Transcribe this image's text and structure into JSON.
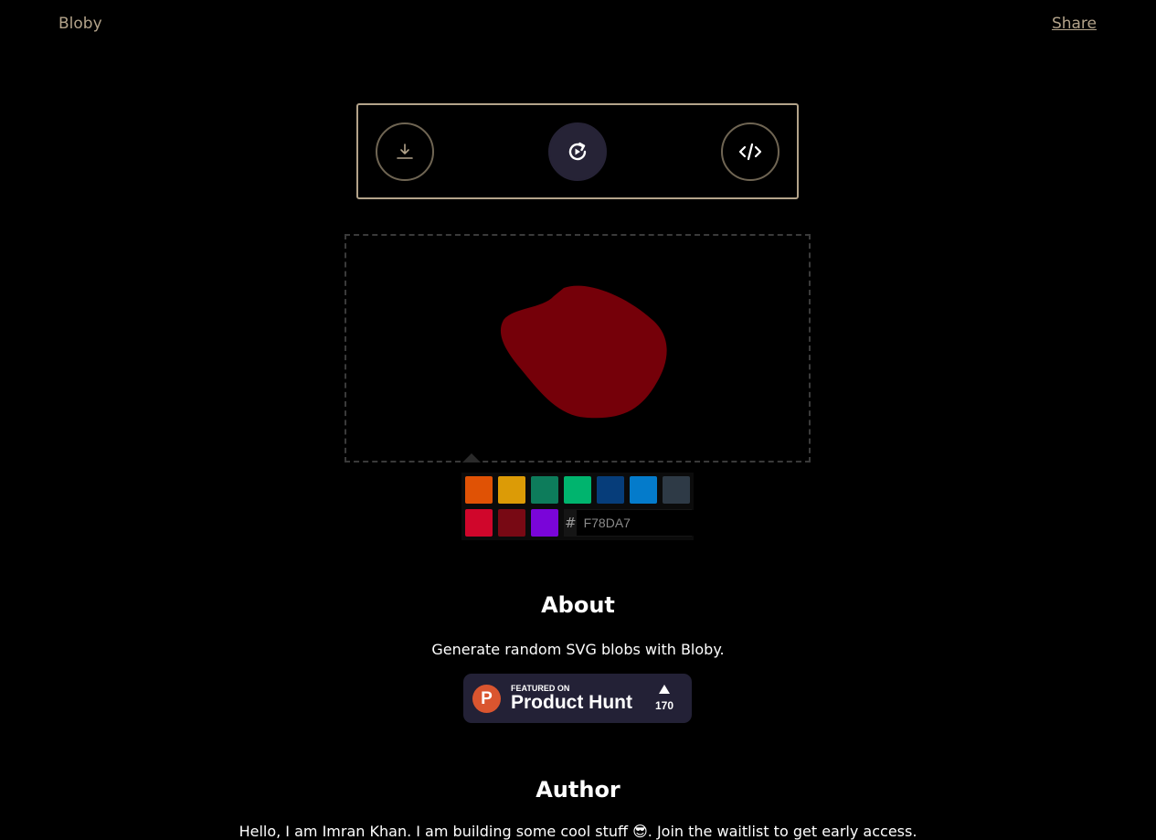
{
  "header": {
    "logo": "Bloby",
    "share_label": "Share"
  },
  "toolbar": {
    "download_icon": "download-icon",
    "regenerate_icon": "regenerate-icon",
    "code_icon": "code-icon"
  },
  "blob": {
    "fill": "#750009"
  },
  "palette": {
    "swatches": [
      "#E05205",
      "#DC9B06",
      "#0D7C5B",
      "#00B46E",
      "#063D7A",
      "#047BCB",
      "#2E3A46",
      "#D0062B",
      "#780914",
      "#7A05D9"
    ],
    "hex_prefix": "#",
    "hex_value": "F78DA7"
  },
  "about": {
    "title": "About",
    "text": "Generate random SVG blobs with Bloby."
  },
  "product_hunt": {
    "featured_on": "FEATURED ON",
    "name": "Product Hunt",
    "count": "170"
  },
  "author": {
    "title": "Author",
    "text": "Hello, I am Imran Khan. I am building some cool stuff 😎. Join the waitlist to get early access."
  }
}
